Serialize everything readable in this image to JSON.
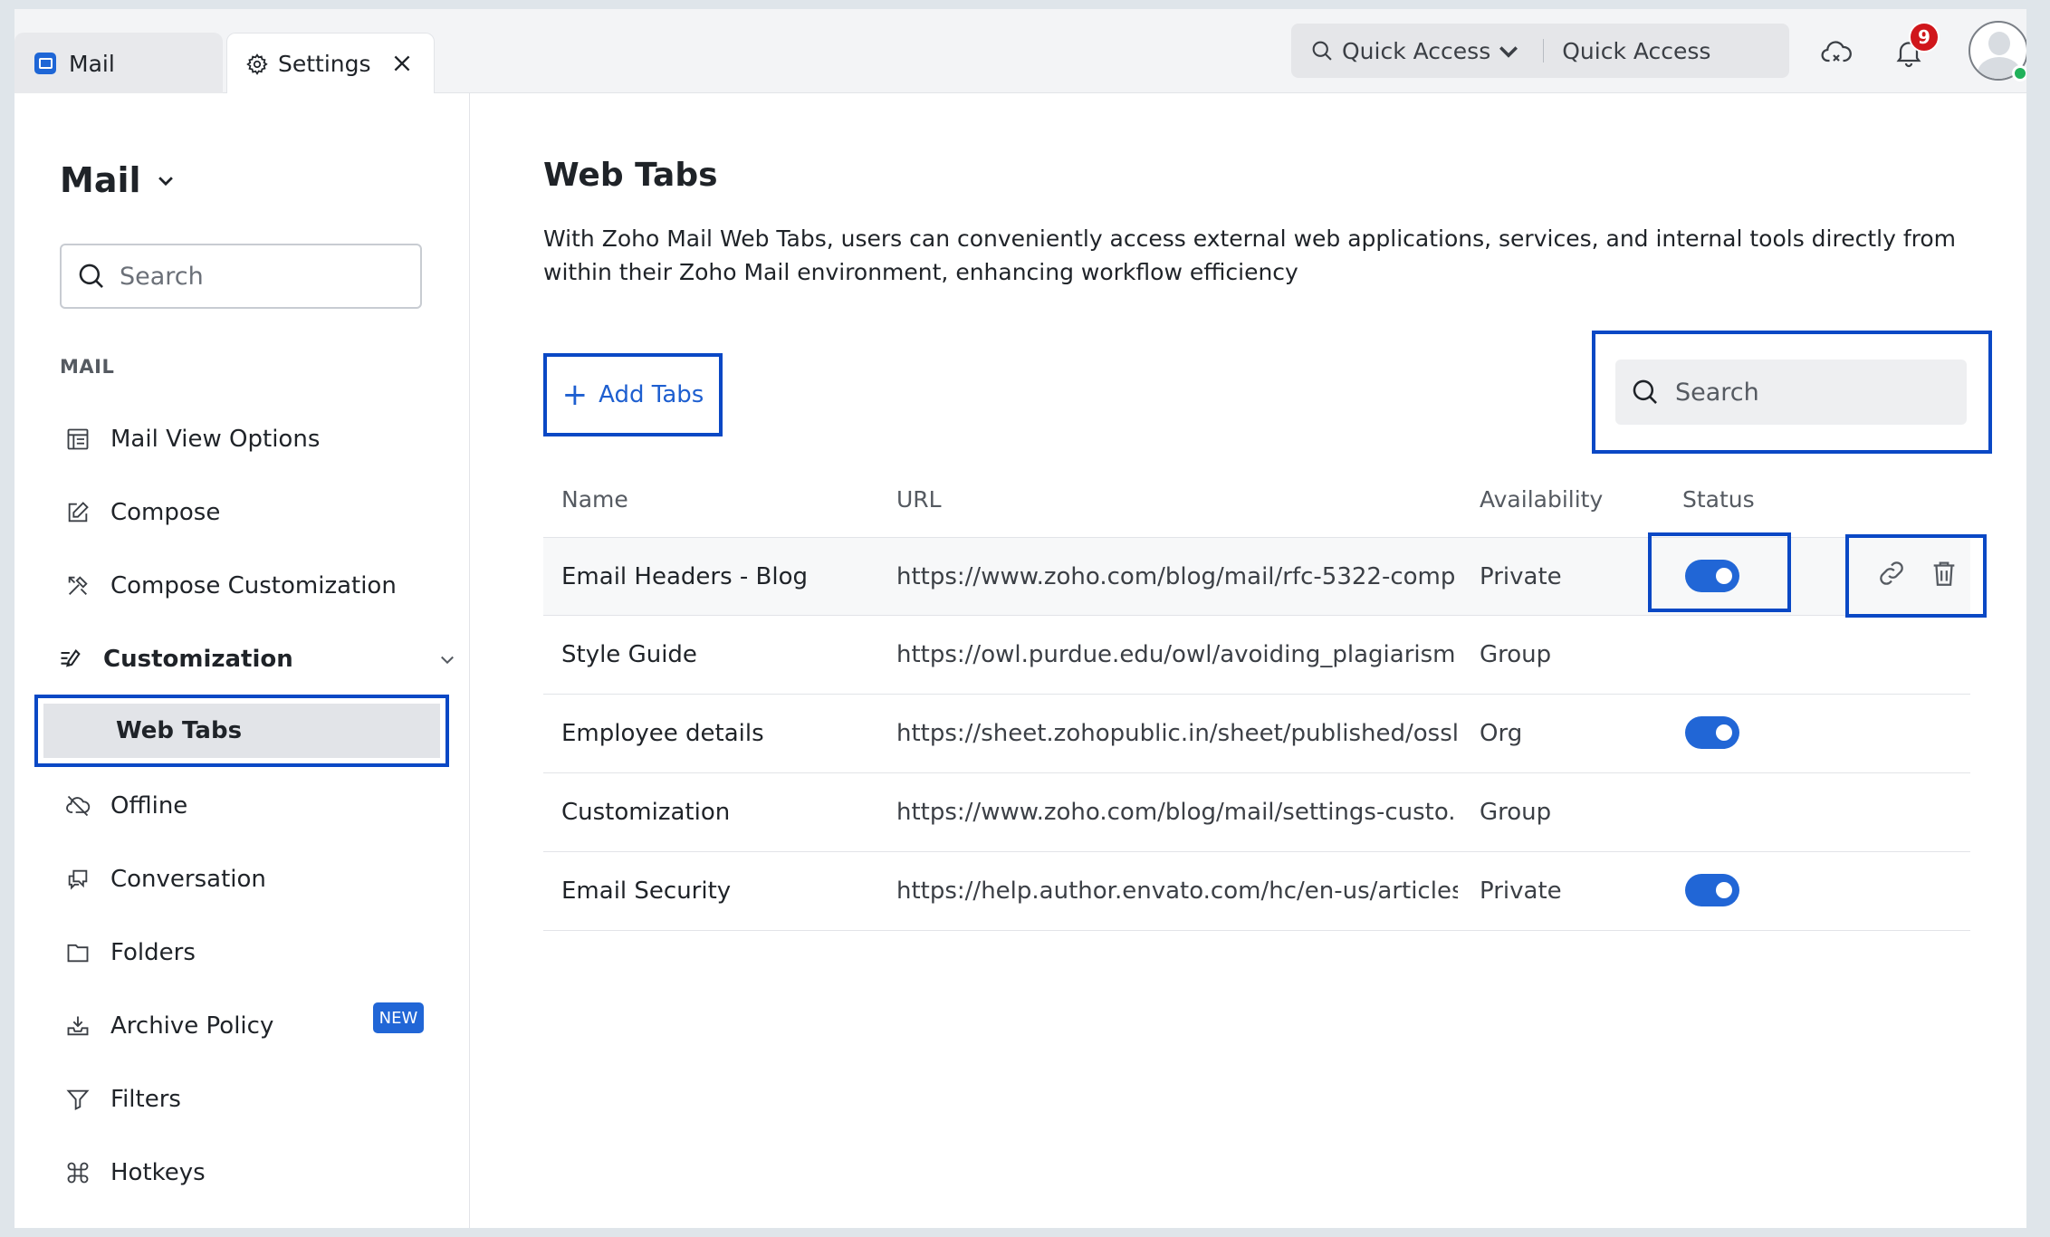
{
  "tabs": {
    "mail_label": "Mail",
    "settings_label": "Settings"
  },
  "quick_access": {
    "dropdown_label": "Quick Access",
    "placeholder": "Quick Access"
  },
  "notifications": {
    "count": "9"
  },
  "sidebar": {
    "title": "Mail",
    "search_placeholder": "Search",
    "section_label": "MAIL",
    "items": [
      {
        "label": "Mail View Options",
        "icon": "layout-icon"
      },
      {
        "label": "Compose",
        "icon": "edit-icon"
      },
      {
        "label": "Compose Customization",
        "icon": "tools-icon"
      },
      {
        "label": "Customization",
        "icon": "customize-icon"
      },
      {
        "label": "Web Tabs",
        "icon": ""
      },
      {
        "label": "Offline",
        "icon": "cloud-off-icon"
      },
      {
        "label": "Conversation",
        "icon": "chat-icon"
      },
      {
        "label": "Folders",
        "icon": "folder-icon"
      },
      {
        "label": "Archive Policy",
        "icon": "archive-icon"
      },
      {
        "label": "Filters",
        "icon": "filter-icon"
      },
      {
        "label": "Hotkeys",
        "icon": "command-icon"
      }
    ],
    "new_badge": "NEW"
  },
  "main": {
    "title": "Web Tabs",
    "description": "With Zoho Mail Web Tabs, users can conveniently access external web applications, services, and internal tools directly from within their Zoho Mail environment, enhancing workflow efficiency",
    "add_button": "Add Tabs",
    "search_placeholder": "Search",
    "columns": [
      "Name",
      "URL",
      "Availability",
      "Status"
    ],
    "rows": [
      {
        "name": "Email Headers - Blog",
        "url": "https://www.zoho.com/blog/mail/rfc-5322-comp...",
        "availability": "Private",
        "status_on": true
      },
      {
        "name": "Style Guide",
        "url": "https://owl.purdue.edu/owl/avoiding_plagiarism...",
        "availability": "Group",
        "status_on": false
      },
      {
        "name": "Employee details",
        "url": "https://sheet.zohopublic.in/sheet/published/ossl...",
        "availability": "Org",
        "status_on": true
      },
      {
        "name": "Customization",
        "url": "https://www.zoho.com/blog/mail/settings-custo...",
        "availability": "Group",
        "status_on": false
      },
      {
        "name": "Email Security",
        "url": "https://help.author.envato.com/hc/en-us/articles...",
        "availability": "Private",
        "status_on": true
      }
    ]
  },
  "colors": {
    "accent": "#2166d6",
    "highlight": "#0a48c5",
    "badge": "#d0161b"
  }
}
